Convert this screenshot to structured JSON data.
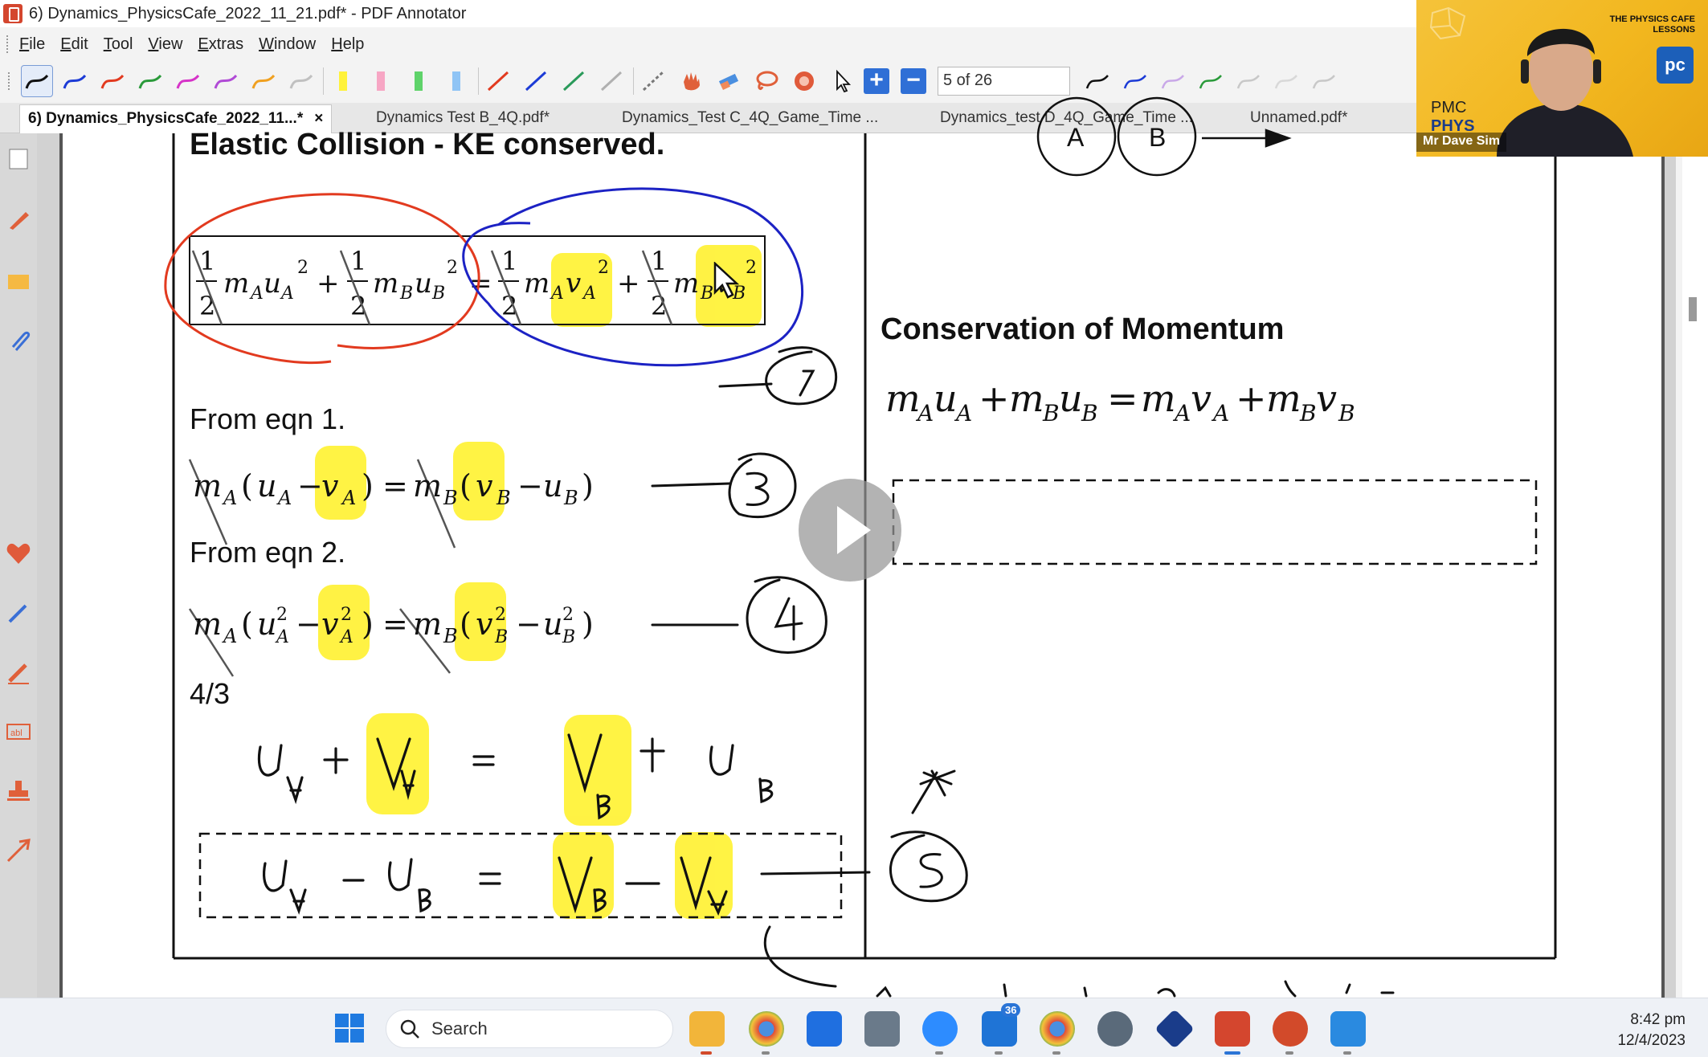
{
  "window": {
    "title": "6) Dynamics_PhysicsCafe_2022_11_21.pdf* - PDF Annotator"
  },
  "menu": [
    "File",
    "Edit",
    "Tool",
    "View",
    "Extras",
    "Window",
    "Help"
  ],
  "toolbar": {
    "page_indicator": "5 of 26",
    "zoom_in_label": "+",
    "zoom_out_label": "−"
  },
  "tabs": [
    {
      "label": "6) Dynamics_PhysicsCafe_2022_11...*",
      "active": true,
      "close": "×"
    },
    {
      "label": "Dynamics Test B_4Q.pdf*",
      "active": false
    },
    {
      "label": "Dynamics_Test C_4Q_Game_Time ...",
      "active": false
    },
    {
      "label": "Dynamics_test D_4Q_Game_Time ...",
      "active": false
    },
    {
      "label": "Unnamed.pdf*",
      "active": false
    }
  ],
  "page": {
    "left": {
      "heading": "Elastic Collision - KE conserved.",
      "eqn_ke": "½m_Au_A² + ½m_Bu_B² = ½m_Av_A² + ½m_Bv_B²",
      "from1": "From eqn 1.",
      "from2": "From eqn 2.",
      "ratio": "4/3"
    },
    "right": {
      "heading": "Conservation of Momentum",
      "labels": [
        "A",
        "B"
      ]
    },
    "handwriting": {
      "eq_numbers": [
        "2",
        "3",
        "4",
        "5"
      ]
    }
  },
  "webcam": {
    "brand": "THE PHYSICS CAFE",
    "brand_sub": "LESSONS",
    "pmc": "PMC",
    "phys": "PHYS",
    "logo": "pc",
    "presenter": "Mr Dave Sim"
  },
  "taskbar": {
    "search_placeholder": "Search",
    "mail_badge": "36",
    "time": "8:42 pm",
    "date": "12/4/2023"
  },
  "colors": {
    "highlight": "#fff23a",
    "ink_red": "#e23a1f",
    "ink_blue": "#1c22c4",
    "accent": "#2f6fd6"
  }
}
